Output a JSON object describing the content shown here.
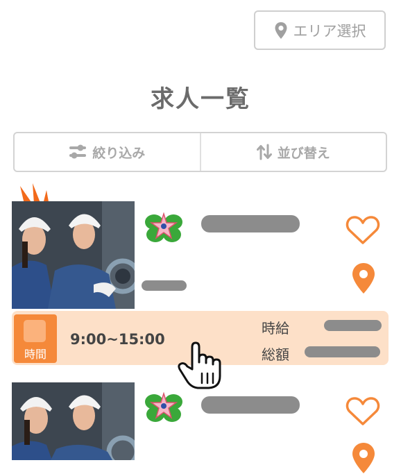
{
  "header": {
    "area_button_label": "エリア選択",
    "area_icon": "map-pin-icon"
  },
  "page_title": "求人一覧",
  "controls": {
    "filter_label": "絞り込み",
    "filter_icon": "sliders-icon",
    "sort_label": "並び替え",
    "sort_icon": "sort-arrows-icon"
  },
  "job_listings": [
    {
      "time_badge_label": "時間",
      "hours": "9:00~15:00",
      "hourly_wage_label": "時給",
      "total_pay_label": "総額"
    }
  ],
  "colors": {
    "accent": "#f5893a",
    "strip_background": "#fde0c8",
    "placeholder_bar": "#8c8c8c",
    "border": "#cfcfcf"
  }
}
